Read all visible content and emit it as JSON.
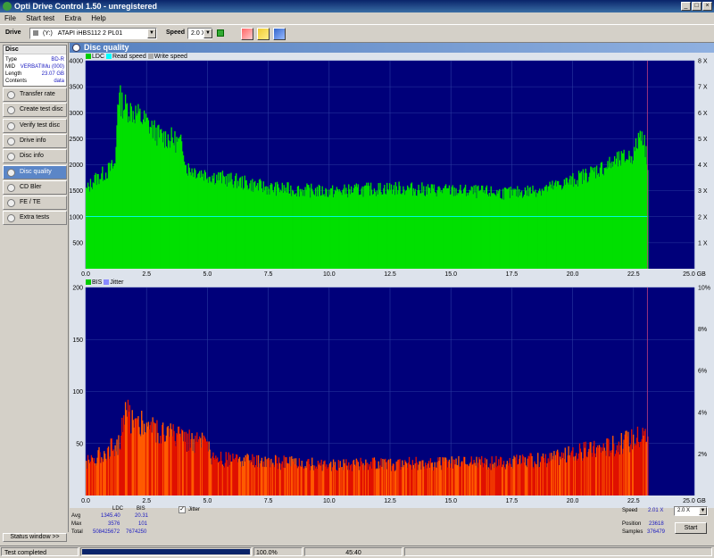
{
  "window": {
    "title": "Opti Drive Control 1.50 - unregistered"
  },
  "menu": [
    "File",
    "Start test",
    "Extra",
    "Help"
  ],
  "toolbar": {
    "drive_label": "Drive",
    "drive_letter": "(Y:)",
    "drive_value": "ATAPI  iHBS112   2 PL01",
    "speed_label": "Speed",
    "speed_value": "2.0 X"
  },
  "disc": {
    "header": "Disc",
    "rows": [
      {
        "k": "Type",
        "v": "BD-R"
      },
      {
        "k": "MID",
        "v": "VERBATIMu (000)"
      },
      {
        "k": "Length",
        "v": "23.07 GB"
      },
      {
        "k": "Contents",
        "v": "data"
      }
    ]
  },
  "nav": [
    {
      "label": "Transfer rate",
      "active": false
    },
    {
      "label": "Create test disc",
      "active": false
    },
    {
      "label": "Verify test disc",
      "active": false
    },
    {
      "label": "Drive info",
      "active": false
    },
    {
      "label": "Disc info",
      "active": false
    },
    {
      "label": "Disc quality",
      "active": true
    },
    {
      "label": "CD Bler",
      "active": false
    },
    {
      "label": "FE / TE",
      "active": false
    },
    {
      "label": "Extra tests",
      "active": false
    }
  ],
  "status_window_label": "Status window >>",
  "panel_title": "Disc quality",
  "colors": {
    "ldc": "#00ff00",
    "bis": "#ff0000",
    "speed": "#00ffff",
    "plot_bg": "#00007a"
  },
  "chart_data": [
    {
      "type": "area",
      "legend": [
        "LDC",
        "Read speed",
        "Write speed"
      ],
      "x_ticks": [
        "0.0",
        "2.5",
        "5.0",
        "7.5",
        "10.0",
        "12.5",
        "15.0",
        "17.5",
        "20.0",
        "22.5",
        "25.0 GB"
      ],
      "y_ticks": [
        "4000",
        "3500",
        "3000",
        "2500",
        "2000",
        "1500",
        "1000",
        "500"
      ],
      "y2_ticks": [
        "8 X",
        "7 X",
        "6 X",
        "5 X",
        "4 X",
        "3 X",
        "2 X",
        "1 X"
      ],
      "xlim": [
        0,
        25
      ],
      "ylim": [
        0,
        4000
      ],
      "y2lim": [
        0,
        8
      ],
      "ldc": {
        "x": [
          0,
          0.3,
          0.8,
          1.2,
          1.3,
          1.5,
          2,
          2.5,
          3,
          3.5,
          4,
          4.1,
          5,
          6,
          7.5,
          10,
          12.5,
          15,
          17.5,
          19,
          20,
          21,
          22,
          22.5,
          22.8,
          23.07
        ],
        "y": [
          1500,
          1700,
          1850,
          2000,
          3350,
          3150,
          3000,
          2800,
          2550,
          2500,
          2350,
          1950,
          1800,
          1700,
          1550,
          1480,
          1550,
          1500,
          1450,
          1550,
          1700,
          1900,
          2100,
          2200,
          2700,
          2050
        ]
      },
      "read_speed": {
        "x": [
          0,
          23.07
        ],
        "y": [
          2.01,
          2.01
        ]
      }
    },
    {
      "type": "area",
      "legend": [
        "BIS",
        "Jitter"
      ],
      "x_ticks": [
        "0.0",
        "2.5",
        "5.0",
        "7.5",
        "10.0",
        "12.5",
        "15.0",
        "17.5",
        "20.0",
        "22.5",
        "25.0 GB"
      ],
      "y_ticks": [
        "200",
        "150",
        "100",
        "50"
      ],
      "y2_ticks": [
        "10%",
        "8%",
        "6%",
        "4%",
        "2%"
      ],
      "xlim": [
        0,
        25
      ],
      "ylim": [
        0,
        200
      ],
      "y2lim": [
        0,
        10
      ],
      "bis": {
        "x": [
          0,
          1,
          1.4,
          1.6,
          2,
          2.5,
          3,
          4,
          5,
          5.1,
          7.5,
          10,
          12.5,
          15,
          17.5,
          19,
          20,
          21,
          22,
          22.5,
          23.07
        ],
        "y": [
          32,
          45,
          52,
          80,
          72,
          68,
          62,
          55,
          48,
          35,
          32,
          30,
          30,
          31,
          32,
          35,
          40,
          45,
          50,
          55,
          60
        ]
      }
    }
  ],
  "stats": {
    "col_ldc": "LDC",
    "col_bis": "BIS",
    "rows": [
      {
        "label": "Avg",
        "ldc": "1345.40",
        "bis": "20.31"
      },
      {
        "label": "Max",
        "ldc": "3576",
        "bis": "101"
      },
      {
        "label": "Total",
        "ldc": "508425672",
        "bis": "7674250"
      }
    ],
    "jitter_label": "Jitter",
    "speed_label": "Speed",
    "speed_value": "2.01 X",
    "position_label": "Position",
    "position_value": "23618",
    "samples_label": "Samples",
    "samples_value": "376479",
    "speed_select": "2.0 X",
    "start_label": "Start"
  },
  "statusbar": {
    "text": "Test completed",
    "progress": "100.0%",
    "progress_value": 100,
    "time": "45:40"
  }
}
